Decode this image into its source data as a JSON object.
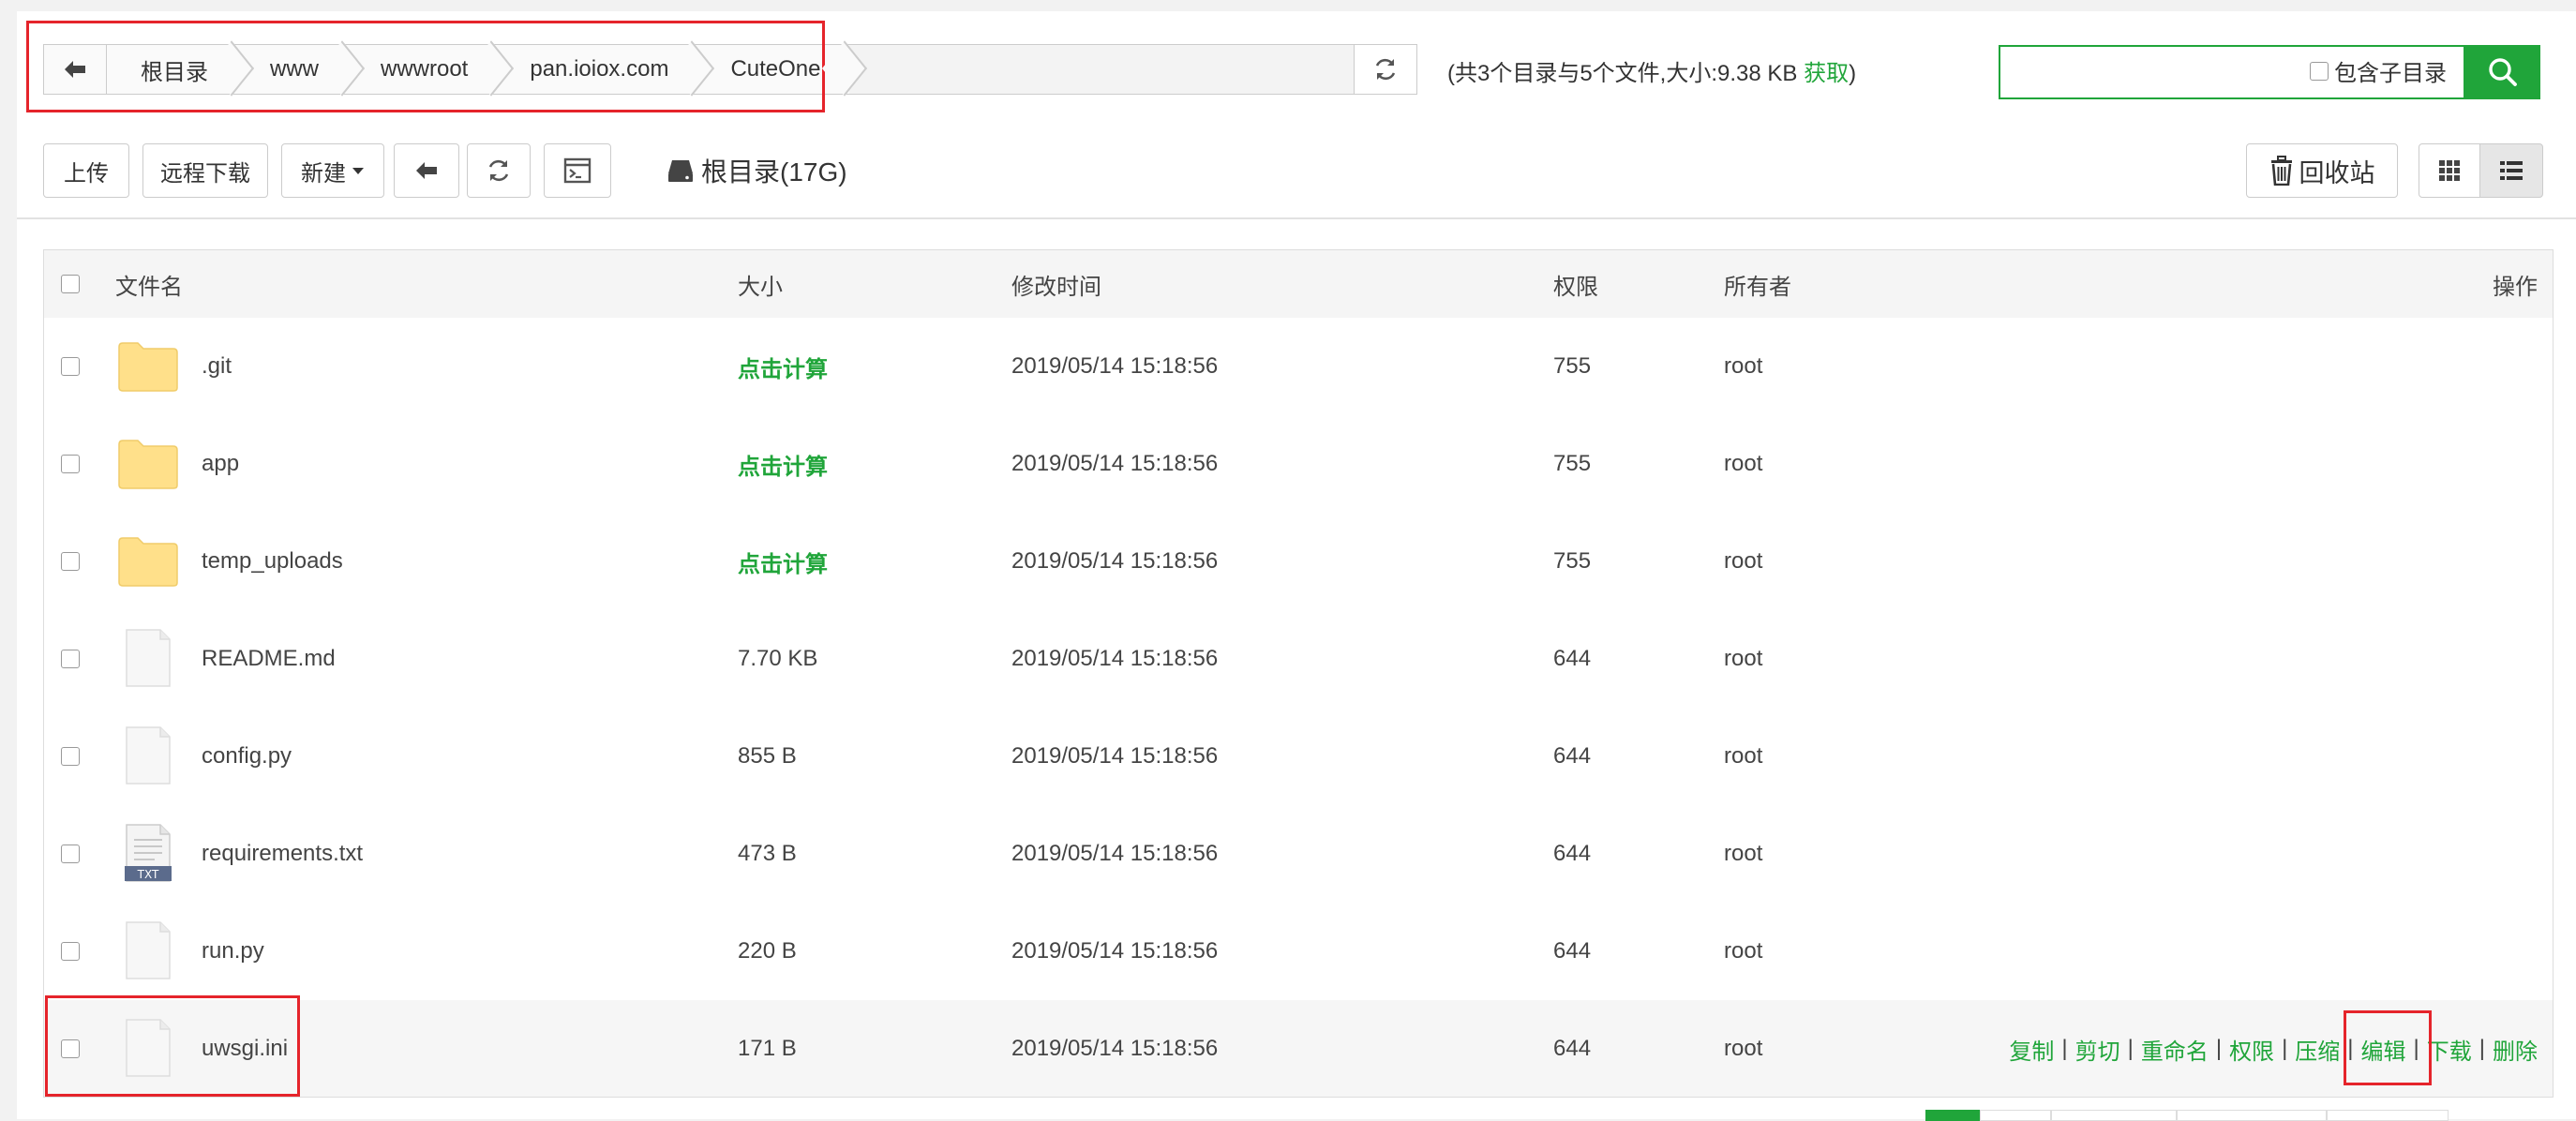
{
  "breadcrumb": [
    "根目录",
    "www",
    "wwwroot",
    "pan.ioiox.com",
    "CuteOne"
  ],
  "summary": {
    "prefix": "(共3个目录与5个文件,大小:9.38 KB ",
    "get_link": "获取",
    "suffix": ")"
  },
  "search": {
    "placeholder": "",
    "include_subdir_label": "包含子目录"
  },
  "toolbar": {
    "upload": "上传",
    "remote_download": "远程下载",
    "new": "新建",
    "disk_label": "根目录(17G)",
    "recycle_bin": "回收站"
  },
  "table": {
    "headers": {
      "name": "文件名",
      "size": "大小",
      "mtime": "修改时间",
      "perm": "权限",
      "owner": "所有者",
      "ops": "操作"
    },
    "rows": [
      {
        "type": "folder",
        "name": ".git",
        "size": "点击计算",
        "mtime": "2019/05/14 15:18:56",
        "perm": "755",
        "owner": "root"
      },
      {
        "type": "folder",
        "name": "app",
        "size": "点击计算",
        "mtime": "2019/05/14 15:18:56",
        "perm": "755",
        "owner": "root"
      },
      {
        "type": "folder",
        "name": "temp_uploads",
        "size": "点击计算",
        "mtime": "2019/05/14 15:18:56",
        "perm": "755",
        "owner": "root"
      },
      {
        "type": "file",
        "name": "README.md",
        "size": "7.70 KB",
        "mtime": "2019/05/14 15:18:56",
        "perm": "644",
        "owner": "root"
      },
      {
        "type": "file",
        "name": "config.py",
        "size": "855 B",
        "mtime": "2019/05/14 15:18:56",
        "perm": "644",
        "owner": "root"
      },
      {
        "type": "txt",
        "name": "requirements.txt",
        "size": "473 B",
        "mtime": "2019/05/14 15:18:56",
        "perm": "644",
        "owner": "root"
      },
      {
        "type": "file",
        "name": "run.py",
        "size": "220 B",
        "mtime": "2019/05/14 15:18:56",
        "perm": "644",
        "owner": "root"
      },
      {
        "type": "file",
        "name": "uwsgi.ini",
        "size": "171 B",
        "mtime": "2019/05/14 15:18:56",
        "perm": "644",
        "owner": "root"
      }
    ],
    "row_ops": [
      "复制",
      "剪切",
      "重命名",
      "权限",
      "压缩",
      "编辑",
      "下载",
      "删除"
    ],
    "txt_badge": "TXT"
  },
  "colors": {
    "accent": "#20a53a",
    "annotation": "#e5242b"
  }
}
